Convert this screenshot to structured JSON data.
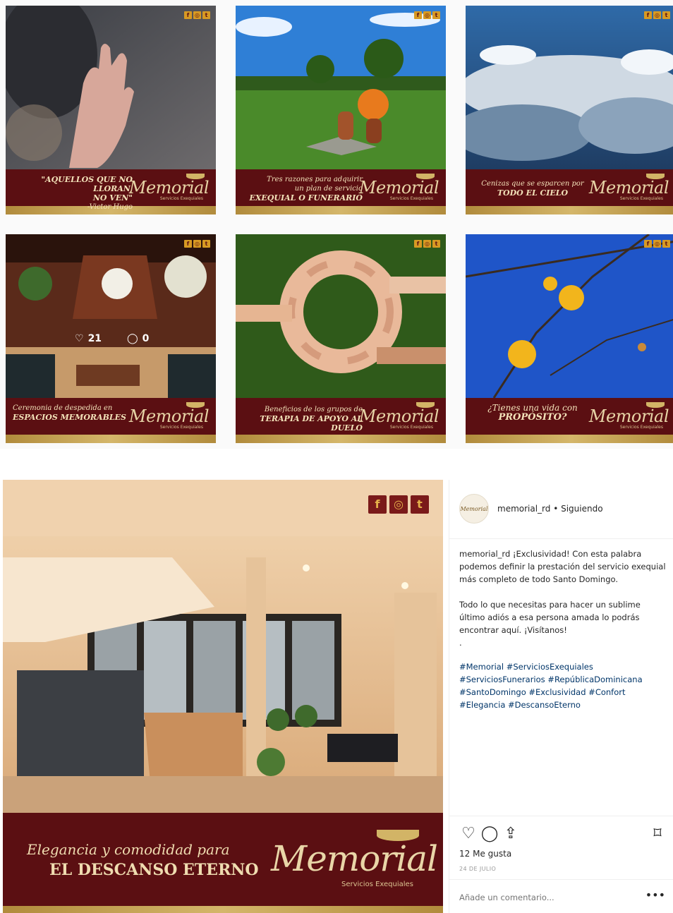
{
  "grid": {
    "tiles": [
      {
        "caption_lines": [
          "\"AQUELLOS QUE NO LLORAN,",
          "NO VEN\"",
          "-Victor Hugo"
        ]
      },
      {
        "caption_lines": [
          "Tres razones para adquirir",
          "un plan de servicio",
          "EXEQUIAL O FUNERARIO"
        ]
      },
      {
        "caption_lines": [
          "Cenizas que se esparcen por",
          "TODO EL CIELO"
        ]
      },
      {
        "caption_lines": [
          "Ceremonia de despedida en",
          "ESPACIOS MEMORABLES"
        ],
        "overlay": {
          "likes": "21",
          "comments": "0"
        }
      },
      {
        "caption_lines": [
          "Beneficios de los grupos de",
          "TERAPIA DE APOYO AL DUELO"
        ]
      },
      {
        "caption_lines": [
          "¿Tienes una vida con",
          "PROPÓSITO?"
        ]
      }
    ],
    "brand_word": "Memorial",
    "brand_sub": "Servicios Exequiales"
  },
  "post": {
    "image_line1": "Elegancia y comodidad para",
    "image_line2": "EL DESCANSO ETERNO",
    "brand_word": "Memorial",
    "brand_sub": "Servicios Exequiales",
    "avatar_text": "Memorial",
    "header_handle": "memorial_rd • Siguiendo",
    "caption": "memorial_rd ¡Exclusividad! Con esta palabra podemos definir la prestación del servicio exequial más completo de todo Santo Domingo.\n\nTodo lo que necesitas para hacer un sublime último adiós a esa persona amada lo podrás encontrar aquí. ¡Visítanos!\n.",
    "hashtags": "#Memorial #ServiciosExequiales #ServiciosFunerarios #RepúblicaDominicana #SantoDomingo #Exclusividad #Confort #Elegancia #DescansoEterno",
    "likes": "12 Me gusta",
    "date": "24 DE JULIO",
    "comment_placeholder": "Añade un comentario...",
    "more": "•••"
  },
  "icons": {
    "facebook": "f",
    "instagram": "◎",
    "twitter": "t",
    "heart": "♡",
    "comment": "◯",
    "share": "⇪",
    "bookmark": "⌑"
  }
}
